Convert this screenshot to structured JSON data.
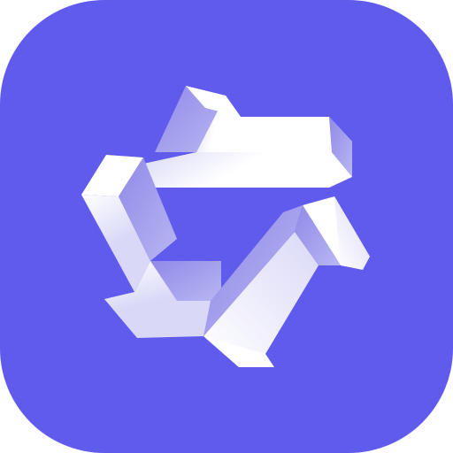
{
  "icon": {
    "name": "tri-fold-knot-logo-icon",
    "colors": {
      "background": "#605bec",
      "strand_light": "#ffffff",
      "strand_mid": "#d9d9f7",
      "strand_shade": "#8f8ae8"
    }
  }
}
